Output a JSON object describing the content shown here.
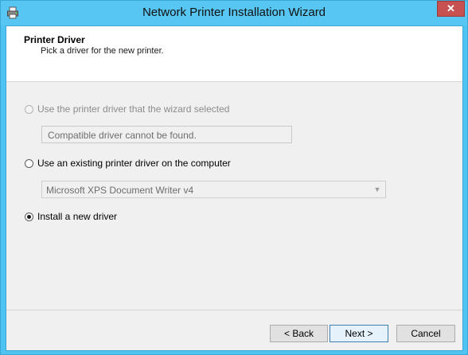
{
  "window": {
    "title": "Network Printer Installation Wizard",
    "app_icon": "printer-icon",
    "close_label": "✕"
  },
  "header": {
    "title": "Printer Driver",
    "subtitle": "Pick a driver for the new printer."
  },
  "options": {
    "wizard_selected": {
      "label": "Use the printer driver that the wizard selected",
      "enabled": false,
      "selected": false,
      "field_value": "Compatible driver cannot be found."
    },
    "existing_driver": {
      "label": "Use an existing printer driver on the computer",
      "enabled": true,
      "selected": false,
      "dropdown_value": "Microsoft XPS Document Writer v4"
    },
    "install_new": {
      "label": "Install a new driver",
      "enabled": true,
      "selected": true
    }
  },
  "buttons": {
    "back": "< Back",
    "next": "Next >",
    "cancel": "Cancel"
  },
  "colors": {
    "title_bar": "#57c6f2",
    "close_button": "#c75050",
    "client_bg": "#f0f0f0"
  }
}
